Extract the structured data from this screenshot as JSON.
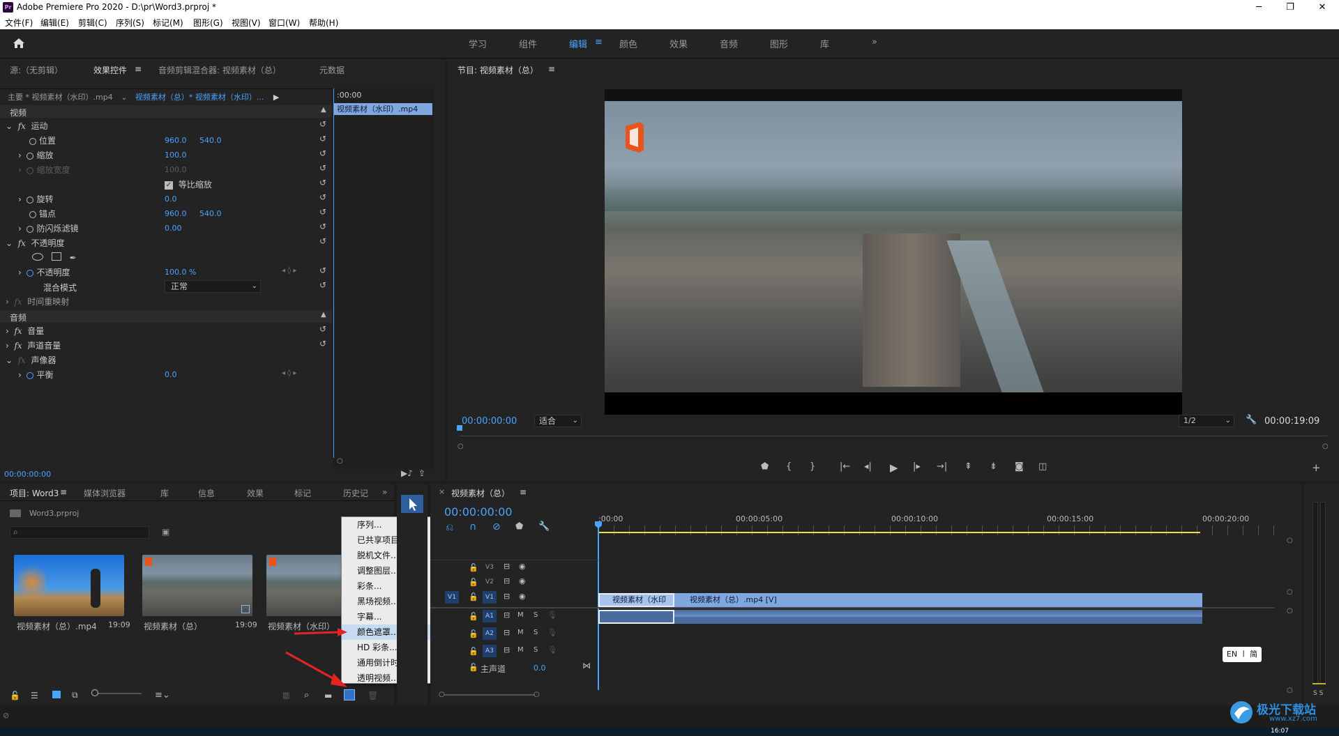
{
  "app": {
    "title": "Adobe Premiere Pro 2020 - D:\\pr\\Word3.prproj *",
    "logo": "Pr"
  },
  "window_controls": {
    "minimize": "─",
    "maximize": "❐",
    "close": "✕"
  },
  "menu": [
    "文件(F)",
    "编辑(E)",
    "剪辑(C)",
    "序列(S)",
    "标记(M)",
    "图形(G)",
    "视图(V)",
    "窗口(W)",
    "帮助(H)"
  ],
  "workspaces": [
    "学习",
    "组件",
    "编辑",
    "颜色",
    "效果",
    "音频",
    "图形",
    "库"
  ],
  "workspaces_more": "»",
  "active_workspace": "编辑",
  "effect_controls": {
    "tabs": [
      "源:（无剪辑）",
      "效果控件",
      "音频剪辑混合器: 视频素材（总）",
      "元数据"
    ],
    "master": "主要 * 视频素材（水印）.mp4",
    "sequence": "视频素材（总）* 视频素材（水印）...",
    "time_head": ":00:00",
    "clip_label": "视频素材（水印）.mp4",
    "section_video": "视频",
    "motion": "运动",
    "position_label": "位置",
    "position_x": "960.0",
    "position_y": "540.0",
    "scale_label": "缩放",
    "scale": "100.0",
    "scale_width_label": "缩放宽度",
    "scale_width": "100.0",
    "uniform_label": "等比缩放",
    "rotation_label": "旋转",
    "rotation": "0.0",
    "anchor_label": "锚点",
    "anchor_x": "960.0",
    "anchor_y": "540.0",
    "flicker_label": "防闪烁滤镜",
    "flicker": "0.00",
    "opacity_group": "不透明度",
    "opacity_label": "不透明度",
    "opacity": "100.0 %",
    "blend_label": "混合模式",
    "blend": "正常",
    "time_remap": "时间重映射",
    "section_audio": "音频",
    "volume": "音量",
    "channel_volume": "声道音量",
    "panner": "声像器",
    "balance_label": "平衡",
    "balance": "0.0",
    "timecode": "00:00:00:00"
  },
  "program": {
    "title": "节目: 视频素材（总）",
    "timecode": "00:00:00:00",
    "fit": "适合",
    "resolution": "1/2",
    "duration": "00:00:19:09"
  },
  "project": {
    "tabs": [
      "项目: Word3",
      "媒体浏览器",
      "库",
      "信息",
      "效果",
      "标记",
      "历史记"
    ],
    "tabs_more": "»",
    "file": "Word3.prproj",
    "items": [
      {
        "name": "视频素材（总）.mp4",
        "duration": "19:09"
      },
      {
        "name": "视频素材（总）",
        "duration": "19:09"
      },
      {
        "name": "视频素材（水印）",
        "duration": ""
      }
    ]
  },
  "context_menu": {
    "items": [
      "序列...",
      "已共享项目...",
      "脱机文件...",
      "调整图层...",
      "彩条...",
      "黑场视频...",
      "字幕...",
      "颜色遮罩...",
      "HD 彩条...",
      "通用倒计时片头...",
      "透明视频..."
    ],
    "highlighted": "颜色遮罩..."
  },
  "timeline": {
    "title": "视频素材（总）",
    "timecode": "00:00:00:00",
    "ruler": [
      ":00:00",
      "00:00:05:00",
      "00:00:10:00",
      "00:00:15:00",
      "00:00:20:00"
    ],
    "tracks_video": [
      "V3",
      "V2",
      "V1"
    ],
    "tracks_audio": [
      "A1",
      "A2",
      "A3"
    ],
    "mute": "M",
    "solo": "S",
    "master": "主声道",
    "master_value": "0.0",
    "clip1": "视频素材（水印",
    "clip2": "视频素材（总）.mp4 [V]",
    "source_patch_video": "V1"
  },
  "meter": {
    "solo_labels": "S S"
  },
  "ime": "EN ㇑ 简",
  "watermark": {
    "site": "极光下载站",
    "url": "www.xz7.com"
  },
  "taskbar": {
    "time": "16:07"
  },
  "colors": {
    "accent": "#4aa3ff",
    "clip_video": "#7fa7e0",
    "clip_audio": "#4a6b9e",
    "yellow": "#e9e23a"
  }
}
